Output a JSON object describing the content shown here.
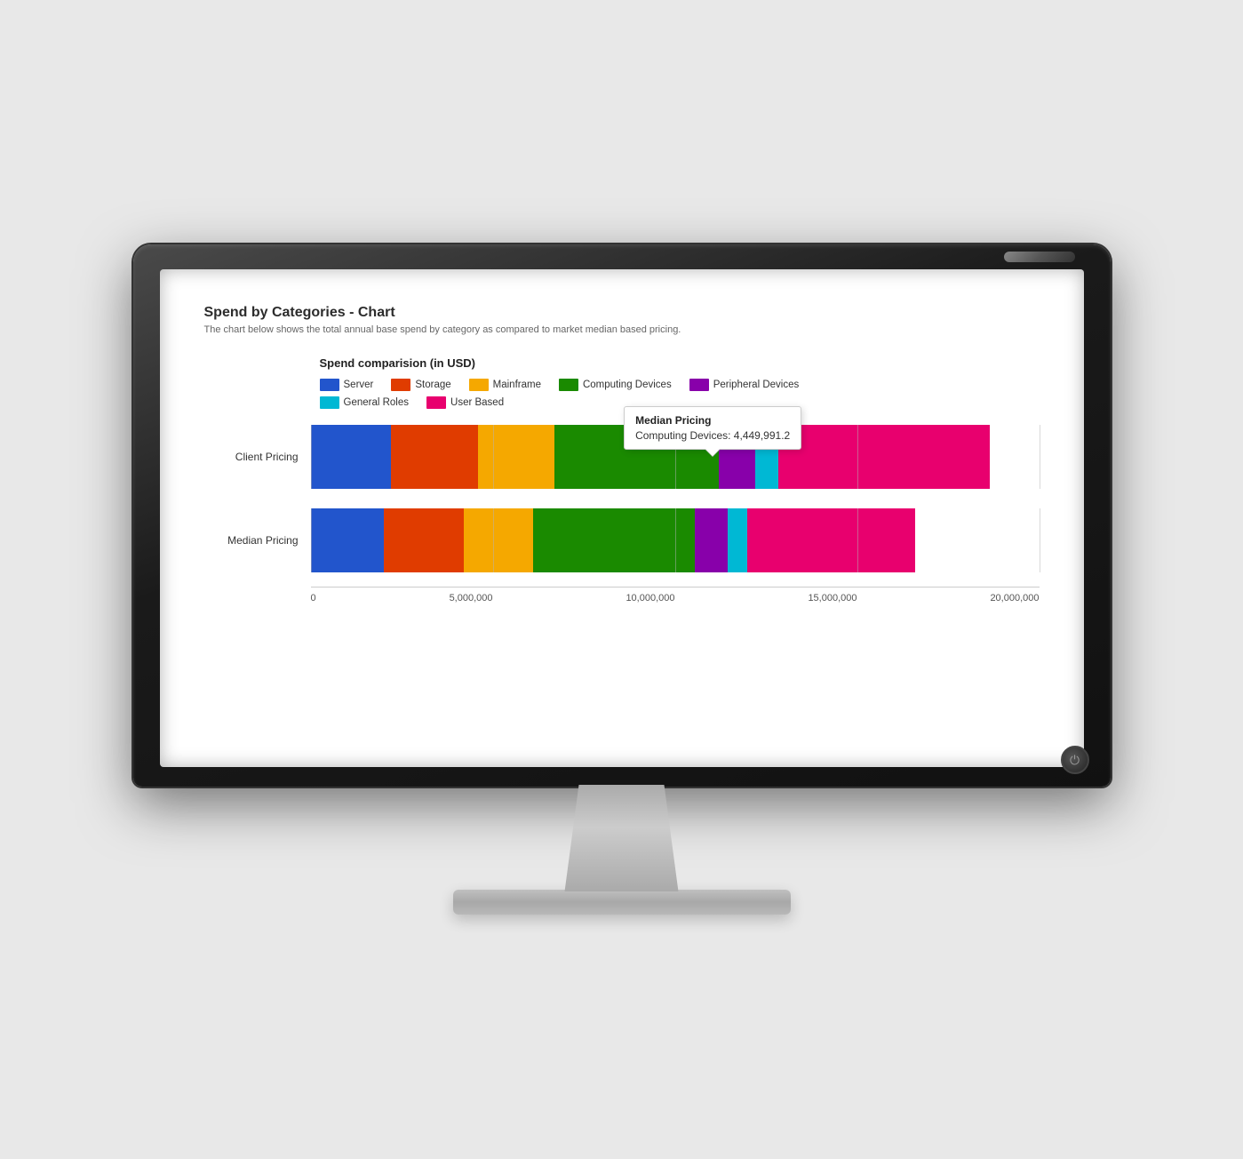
{
  "chart": {
    "title": "Spend by Categories - Chart",
    "subtitle": "The chart below shows the total annual base spend by category as compared to market median based pricing.",
    "heading": "Spend comparision (in USD)",
    "legend": [
      {
        "label": "Server",
        "color": "#2255cc"
      },
      {
        "label": "Storage",
        "color": "#e03c00"
      },
      {
        "label": "Mainframe",
        "color": "#f5a800"
      },
      {
        "label": "Computing Devices",
        "color": "#1a8a00"
      },
      {
        "label": "Peripheral Devices",
        "color": "#8800aa"
      },
      {
        "label": "General Roles",
        "color": "#00b8d4"
      },
      {
        "label": "User Based",
        "color": "#e8006e"
      }
    ],
    "xAxis": {
      "labels": [
        "0",
        "5,000,000",
        "10,000,000",
        "15,000,000",
        "20,000,000"
      ],
      "max": 20000000
    },
    "bars": [
      {
        "label": "Client Pricing",
        "segments": [
          {
            "category": "Server",
            "value": 2200000,
            "color": "#2255cc"
          },
          {
            "category": "Storage",
            "value": 2400000,
            "color": "#e03c00"
          },
          {
            "category": "Mainframe",
            "value": 2100000,
            "color": "#f5a800"
          },
          {
            "category": "Computing Devices",
            "value": 4500000,
            "color": "#1a8a00"
          },
          {
            "category": "Peripheral Devices",
            "value": 1000000,
            "color": "#8800aa"
          },
          {
            "category": "General Roles",
            "value": 650000,
            "color": "#00b8d4"
          },
          {
            "category": "User Based",
            "value": 5800000,
            "color": "#e8006e"
          }
        ]
      },
      {
        "label": "Median Pricing",
        "segments": [
          {
            "category": "Server",
            "value": 2000000,
            "color": "#2255cc"
          },
          {
            "category": "Storage",
            "value": 2200000,
            "color": "#e03c00"
          },
          {
            "category": "Mainframe",
            "value": 1900000,
            "color": "#f5a800"
          },
          {
            "category": "Computing Devices",
            "value": 4449991,
            "color": "#1a8a00"
          },
          {
            "category": "Peripheral Devices",
            "value": 900000,
            "color": "#8800aa"
          },
          {
            "category": "General Roles",
            "value": 550000,
            "color": "#00b8d4"
          },
          {
            "category": "User Based",
            "value": 4600000,
            "color": "#e8006e"
          }
        ]
      }
    ],
    "tooltip": {
      "title": "Median Pricing",
      "label": "Computing Devices:",
      "value": "4,449,991.2"
    }
  },
  "monitor": {
    "power_symbol": "⏻"
  }
}
